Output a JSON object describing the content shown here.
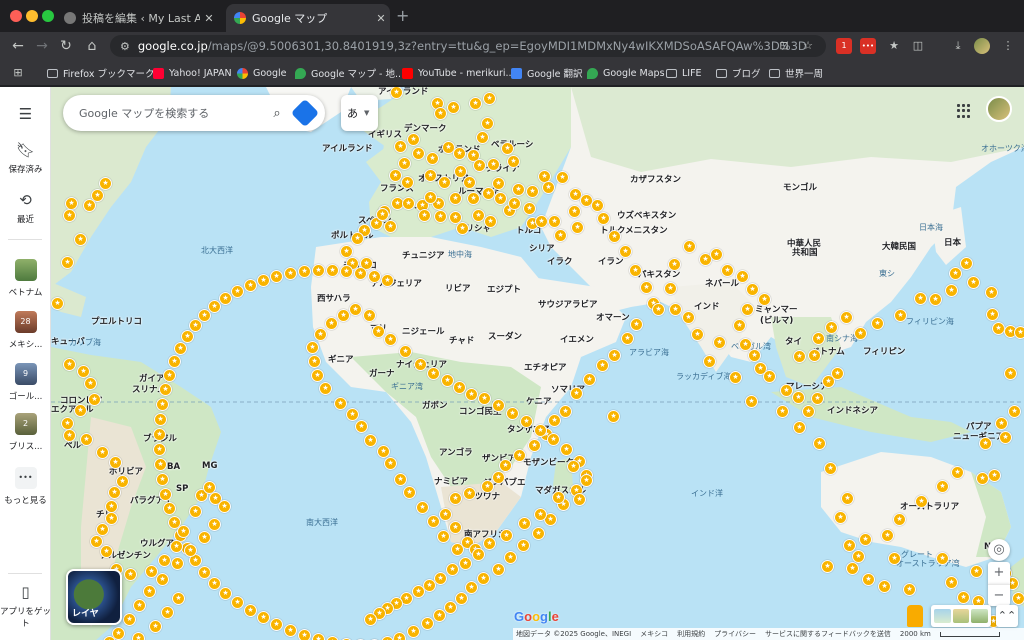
{
  "browser": {
    "tabs": [
      {
        "title": "投稿を編集 ‹ My Last Advent...",
        "close": "✕"
      },
      {
        "title": "Google マップ",
        "close": "✕"
      }
    ],
    "new_tab": "+",
    "url_host": "google.co.jp",
    "url_path": "/maps/@9.5006301,30.8401919,3z?entry=ttu&g_ep=EgoyMDI1MDMxNy4wIKXMDSoASAFQAw%3D%3D",
    "bookmarks": [
      "Firefox ブックマーク",
      "Yahoo! JAPAN",
      "Google",
      "Google マップ - 地...",
      "YouTube - merikuri...",
      "Google 翻訳",
      "Google Maps",
      "LIFE",
      "ブログ",
      "世界一周"
    ],
    "ext_badge": "1",
    "ext_red_label": "•••"
  },
  "rail": {
    "saved": "保存済み",
    "recent": "最近",
    "items": [
      {
        "label": "ベトナム",
        "badge": ""
      },
      {
        "label": "メキシ...",
        "badge": "28"
      },
      {
        "label": "ゴール...",
        "badge": "9"
      },
      {
        "label": "ブリス...",
        "badge": "2"
      }
    ],
    "more": "もっと見る",
    "more_glyph": "•••",
    "get_app": "アプリをゲット"
  },
  "search": {
    "placeholder": "Google マップを検索する"
  },
  "ime": {
    "label": "あ"
  },
  "layers": {
    "label": "レイヤ"
  },
  "countries": [
    {
      "name": "アイスランド"
    },
    {
      "name": "デンマーク"
    },
    {
      "name": "イギリス"
    },
    {
      "name": "アイルランド"
    },
    {
      "name": "ポーランド"
    },
    {
      "name": "ベラルーシ"
    },
    {
      "name": "ウクライナ"
    },
    {
      "name": "オーストリア"
    },
    {
      "name": "フランス"
    },
    {
      "name": "ルーマニア"
    },
    {
      "name": "スペイン"
    },
    {
      "name": "イタリア"
    },
    {
      "name": "ポルトガル"
    },
    {
      "name": "ギリシャ"
    },
    {
      "name": "トルコ"
    },
    {
      "name": "チュニジア"
    },
    {
      "name": "シリア"
    },
    {
      "name": "イラク"
    },
    {
      "name": "モロッコ"
    },
    {
      "name": "アルジェリア"
    },
    {
      "name": "リビア"
    },
    {
      "name": "エジプト"
    },
    {
      "name": "サウジアラビア"
    },
    {
      "name": "西サハラ"
    },
    {
      "name": "マリ"
    },
    {
      "name": "ニジェール"
    },
    {
      "name": "チャド"
    },
    {
      "name": "スーダン"
    },
    {
      "name": "イエメン"
    },
    {
      "name": "オマーン"
    },
    {
      "name": "ギニア"
    },
    {
      "name": "ナイジェリア"
    },
    {
      "name": "ガーナ"
    },
    {
      "name": "エチオピア"
    },
    {
      "name": "ソマリア"
    },
    {
      "name": "ガボン"
    },
    {
      "name": "コンゴ民主"
    },
    {
      "name": "ケニア"
    },
    {
      "name": "タンザニア"
    },
    {
      "name": "アンゴラ"
    },
    {
      "name": "ザンビア"
    },
    {
      "name": "モザンビーク"
    },
    {
      "name": "ナミビア"
    },
    {
      "name": "ジンバブエ"
    },
    {
      "name": "ボツワナ"
    },
    {
      "name": "マダガスカル"
    },
    {
      "name": "南アフリカ"
    },
    {
      "name": "カザフスタン"
    },
    {
      "name": "モンゴル"
    },
    {
      "name": "ウズベキスタン"
    },
    {
      "name": "トルクメニスタン"
    },
    {
      "name": "イラン"
    },
    {
      "name": "パキスタン"
    },
    {
      "name": "ネパール"
    },
    {
      "name": "インド"
    },
    {
      "name": "ミャンマー"
    },
    {
      "name": "(ビルマ)"
    },
    {
      "name": "タイ"
    },
    {
      "name": "ベトナム"
    },
    {
      "name": "フィリピン"
    },
    {
      "name": "マレーシア"
    },
    {
      "name": "インドネシア"
    },
    {
      "name": "パプア"
    },
    {
      "name": "ニューギニア"
    },
    {
      "name": "中華人民"
    },
    {
      "name": "共和国"
    },
    {
      "name": "大韓民国"
    },
    {
      "name": "日本"
    },
    {
      "name": "オーストラリア"
    },
    {
      "name": "NSW"
    },
    {
      "name": "キューバ"
    },
    {
      "name": "プエルトリコ"
    },
    {
      "name": "ガイアナ"
    },
    {
      "name": "スリナム"
    },
    {
      "name": "コロンビア"
    },
    {
      "name": "エクアドル"
    },
    {
      "name": "ブラジル"
    },
    {
      "name": "ペルー"
    },
    {
      "name": "ボリビア"
    },
    {
      "name": "パラグアイ"
    },
    {
      "name": "チリ"
    },
    {
      "name": "ウルグアイ"
    },
    {
      "name": "アルゼンチン"
    },
    {
      "name": "MG"
    },
    {
      "name": "BA"
    },
    {
      "name": "SP"
    }
  ],
  "oceans": [
    {
      "name": "北大西洋"
    },
    {
      "name": "南大西洋"
    },
    {
      "name": "インド洋"
    },
    {
      "name": "地中海"
    },
    {
      "name": "アラビア海"
    },
    {
      "name": "ベンガル湾"
    },
    {
      "name": "ラッカディブ海"
    },
    {
      "name": "南シナ海"
    },
    {
      "name": "フィリピン海"
    },
    {
      "name": "オホーツク海"
    },
    {
      "name": "日本海"
    },
    {
      "name": "カリブ海"
    },
    {
      "name": "ギニア湾"
    },
    {
      "name": "グレート"
    },
    {
      "name": "オーストラリア湾"
    },
    {
      "name": "東シ"
    }
  ],
  "pin_glyph": "★",
  "controls": {
    "locate": "◎",
    "zoom_in": "+",
    "zoom_out": "−",
    "expand": "⌃⌃"
  },
  "google_logo": "Google",
  "footer": {
    "data": "地図データ ©2025 Google、INEGI",
    "country": "メキシコ",
    "terms": "利用規約",
    "privacy": "プライバシー",
    "feedback": "サービスに関するフィードバックを送信",
    "scale": "2000 km"
  },
  "colors": {
    "land": "#f4f3ee",
    "water": "#b9e2f5",
    "green": "#cfe7c5",
    "pin": "#f9b400",
    "accent": "#1a73e8"
  }
}
